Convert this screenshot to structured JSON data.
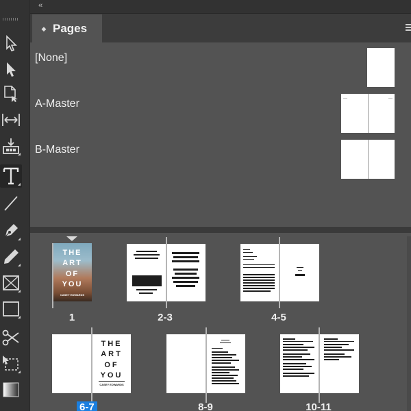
{
  "topbar": {
    "collapse_glyph": "‹‹"
  },
  "panel": {
    "tab_label": "Pages",
    "tab_icon": "chevron-updown-icon",
    "menu_icon": "panel-menu-icon"
  },
  "tools": [
    {
      "name": "selection-tool-icon"
    },
    {
      "name": "direct-selection-tool-icon"
    },
    {
      "name": "page-tool-icon"
    },
    {
      "name": "gap-tool-icon"
    },
    {
      "name": "content-collector-tool-icon"
    },
    {
      "name": "type-tool-icon",
      "active": true
    },
    {
      "name": "line-tool-icon"
    },
    {
      "name": "pen-tool-icon"
    },
    {
      "name": "pencil-tool-icon"
    },
    {
      "name": "rectangle-frame-tool-icon"
    },
    {
      "name": "rectangle-tool-icon"
    },
    {
      "name": "scissors-tool-icon"
    },
    {
      "name": "free-transform-tool-icon"
    },
    {
      "name": "gradient-swatch-tool-icon"
    }
  ],
  "masters": [
    {
      "label": "[None]"
    },
    {
      "label": "A-Master"
    },
    {
      "label": "B-Master"
    }
  ],
  "pages": [
    {
      "label": "1"
    },
    {
      "label": "2-3"
    },
    {
      "label": "4-5"
    },
    {
      "label": "6-7",
      "selected": true
    },
    {
      "label": "8-9"
    },
    {
      "label": "10-11"
    }
  ],
  "cover": {
    "lines": [
      "THE",
      "ART",
      "OF",
      "YOU"
    ],
    "author": "CASEY EDWARDS"
  },
  "spread_6_7": {
    "lines": [
      "THE",
      "ART",
      "OF",
      "YOU"
    ],
    "author": "CASEY EDWARDS"
  }
}
